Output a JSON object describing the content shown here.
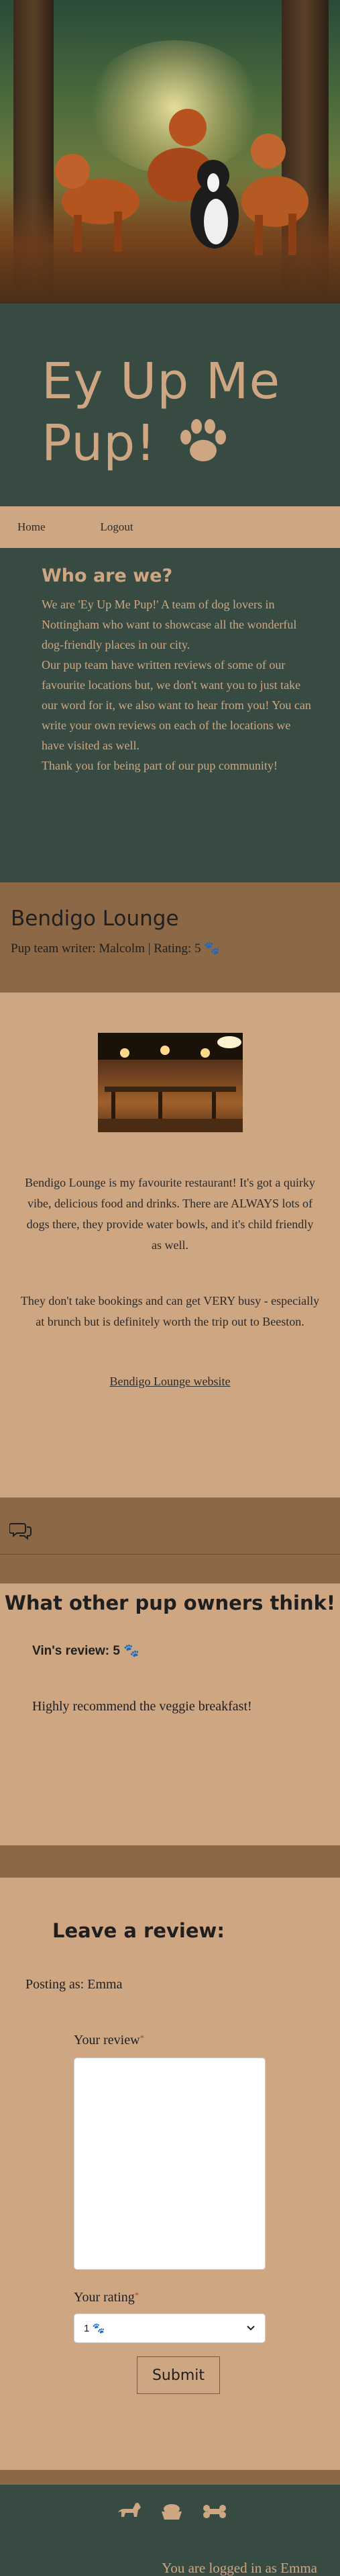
{
  "site": {
    "title_line1": "Ey Up Me",
    "title_line2": "Pup!"
  },
  "nav": {
    "home": "Home",
    "logout": "Logout"
  },
  "about": {
    "heading": "Who are we?",
    "para1": "We are 'Ey Up Me Pup!' A team of dog lovers in Nottingham who want to showcase all the wonderful dog-friendly places in our city.",
    "para2": "Our pup team have written reviews of some of our favourite locations but, we don't want you to just take our word for it, we also want to hear from you! You can write your own reviews on each of the locations we have visited as well.",
    "para3": "Thank you for being part of our pup community!"
  },
  "location": {
    "name": "Bendigo Lounge",
    "meta": "Pup team writer: Malcolm | Rating: 5 🐾",
    "para1": "Bendigo Lounge is my favourite restaurant! It's got a quirky vibe, delicious food and drinks. There are ALWAYS lots of dogs there, they provide water bowls, and it's child friendly as well.",
    "para2": "They don't take bookings and can get VERY busy - especially at brunch but is definitely worth the trip out to Beeston.",
    "link_text": "Bendigo Lounge website"
  },
  "reviews": {
    "heading": "What other pup owners think!",
    "items": [
      {
        "who": "Vin's review: 5 🐾",
        "body": "Highly recommend the veggie breakfast!"
      }
    ]
  },
  "leave_review": {
    "heading": "Leave a review:",
    "posting_as": "Posting as: Emma",
    "review_label": "Your review",
    "rating_label": "Your rating",
    "required_mark": "*",
    "rating_selected": "1 🐾",
    "submit_label": "Submit"
  },
  "footer": {
    "logged_in": "You are logged in as Emma"
  },
  "colors": {
    "dark_green": "#374b43",
    "tan": "#cfa682",
    "brown": "#8c6846"
  }
}
